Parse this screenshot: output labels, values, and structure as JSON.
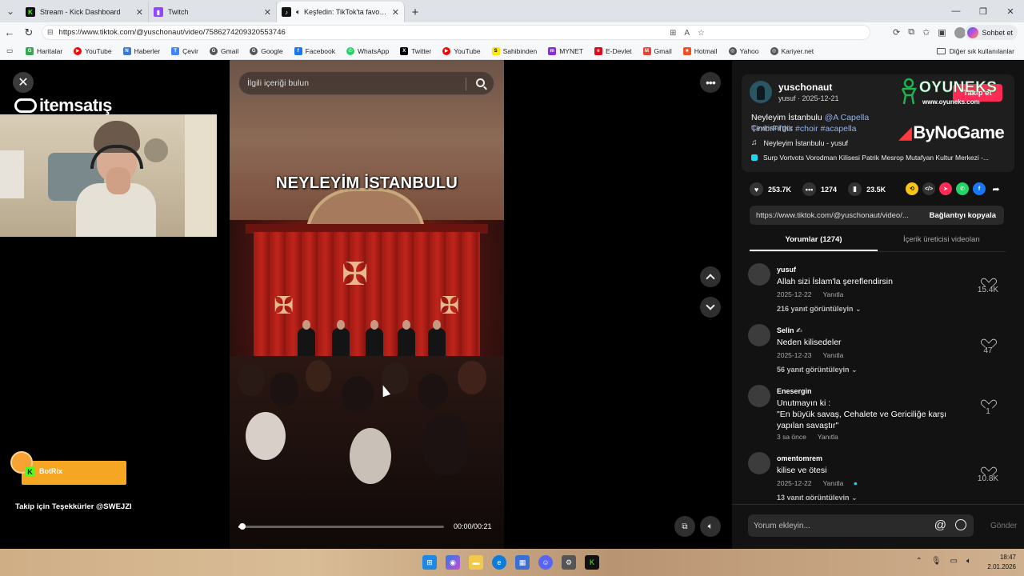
{
  "browser": {
    "tabs": [
      {
        "title": "Stream - Kick Dashboard",
        "active": false
      },
      {
        "title": "Twitch",
        "active": false
      },
      {
        "title": "Keşfedin: TikTok'ta favori video",
        "active": true
      }
    ],
    "url": "https://www.tiktok.com/@yuschonaut/video/7586274209320553746",
    "copilot_label": "Sohbet et",
    "bookmarks": [
      "Haritalar",
      "YouTube",
      "Haberler",
      "Çevir",
      "Gmail",
      "Google",
      "Facebook",
      "WhatsApp",
      "Twitter",
      "YouTube",
      "Sahibinden",
      "MYNET",
      "E-Devlet",
      "Gmail",
      "Hotmail",
      "Yahoo",
      "Kariyer.net"
    ],
    "other_favorites": "Diğer sık kullanılanlar"
  },
  "overlay": {
    "brand": "itemsatış",
    "botrix": "BotRix",
    "follow_thanks": "Takip için Teşekkürler @SWEJZI"
  },
  "video": {
    "search_placeholder": "İlgili içeriği bulun",
    "caption": "NEYLEYİM İSTANBULU",
    "time": "00:00/00:21",
    "progress_fraction": 0.02
  },
  "post": {
    "author": "yuschonaut",
    "author_sub": "yusuf · 2025-12-21",
    "follow_label": "Takip et",
    "description_text": "Neyleyim İstanbulu ",
    "description_tags": "@A Capella TimbrFifths #choir #acapella",
    "see_translation": "Çevirisini gör",
    "music": "Neyleyim İstanbulu - yusuf",
    "location": "Surp Vortvots Vorodman Kilisesi Patrik Mesrop Mutafyan Kultur Merkezi -...",
    "sponsor_oyuneks": "OYUNEKS",
    "sponsor_oyuneks_url": "www.oyuneks.com",
    "sponsor_bynogame": "ByNoGame",
    "likes": "253.7K",
    "comments": "1274",
    "saves": "23.5K",
    "link": "https://www.tiktok.com/@yuschonaut/video/...",
    "copy_link_label": "Bağlantıyı kopyala",
    "tab_comments": "Yorumlar (1274)",
    "tab_creator_videos": "İçerik üreticisi videoları"
  },
  "comments": [
    {
      "user": "yusuf",
      "text": "Allah sizi İslam'la şereflendirsin",
      "date": "2025-12-22",
      "reply": "Yanıtla",
      "likes": "15.4K",
      "more": "216 yanıt görüntüleyin"
    },
    {
      "user": "Selin",
      "text": "Neden kilisedeler",
      "date": "2025-12-23",
      "reply": "Yanıtla",
      "likes": "47",
      "more": "56 yanıt görüntüleyin"
    },
    {
      "user": "Enesergin",
      "text": "Unutmayın ki :\n\"En büyük savaş, Cehalete ve Gericiliğe karşı yapılan savaştır\"",
      "date": "3 sa önce",
      "reply": "Yanıtla",
      "likes": "1",
      "more": ""
    },
    {
      "user": "omentomrem",
      "text": "kilise ve ötesi",
      "date": "2025-12-22",
      "reply": "Yanıtla",
      "likes": "10.8K",
      "more": "13 yanıt görüntüleyin"
    }
  ],
  "add_comment": {
    "placeholder": "Yorum ekleyin...",
    "send": "Gönder"
  },
  "taskbar": {
    "time": "18:47",
    "date": "2.01.2026"
  }
}
